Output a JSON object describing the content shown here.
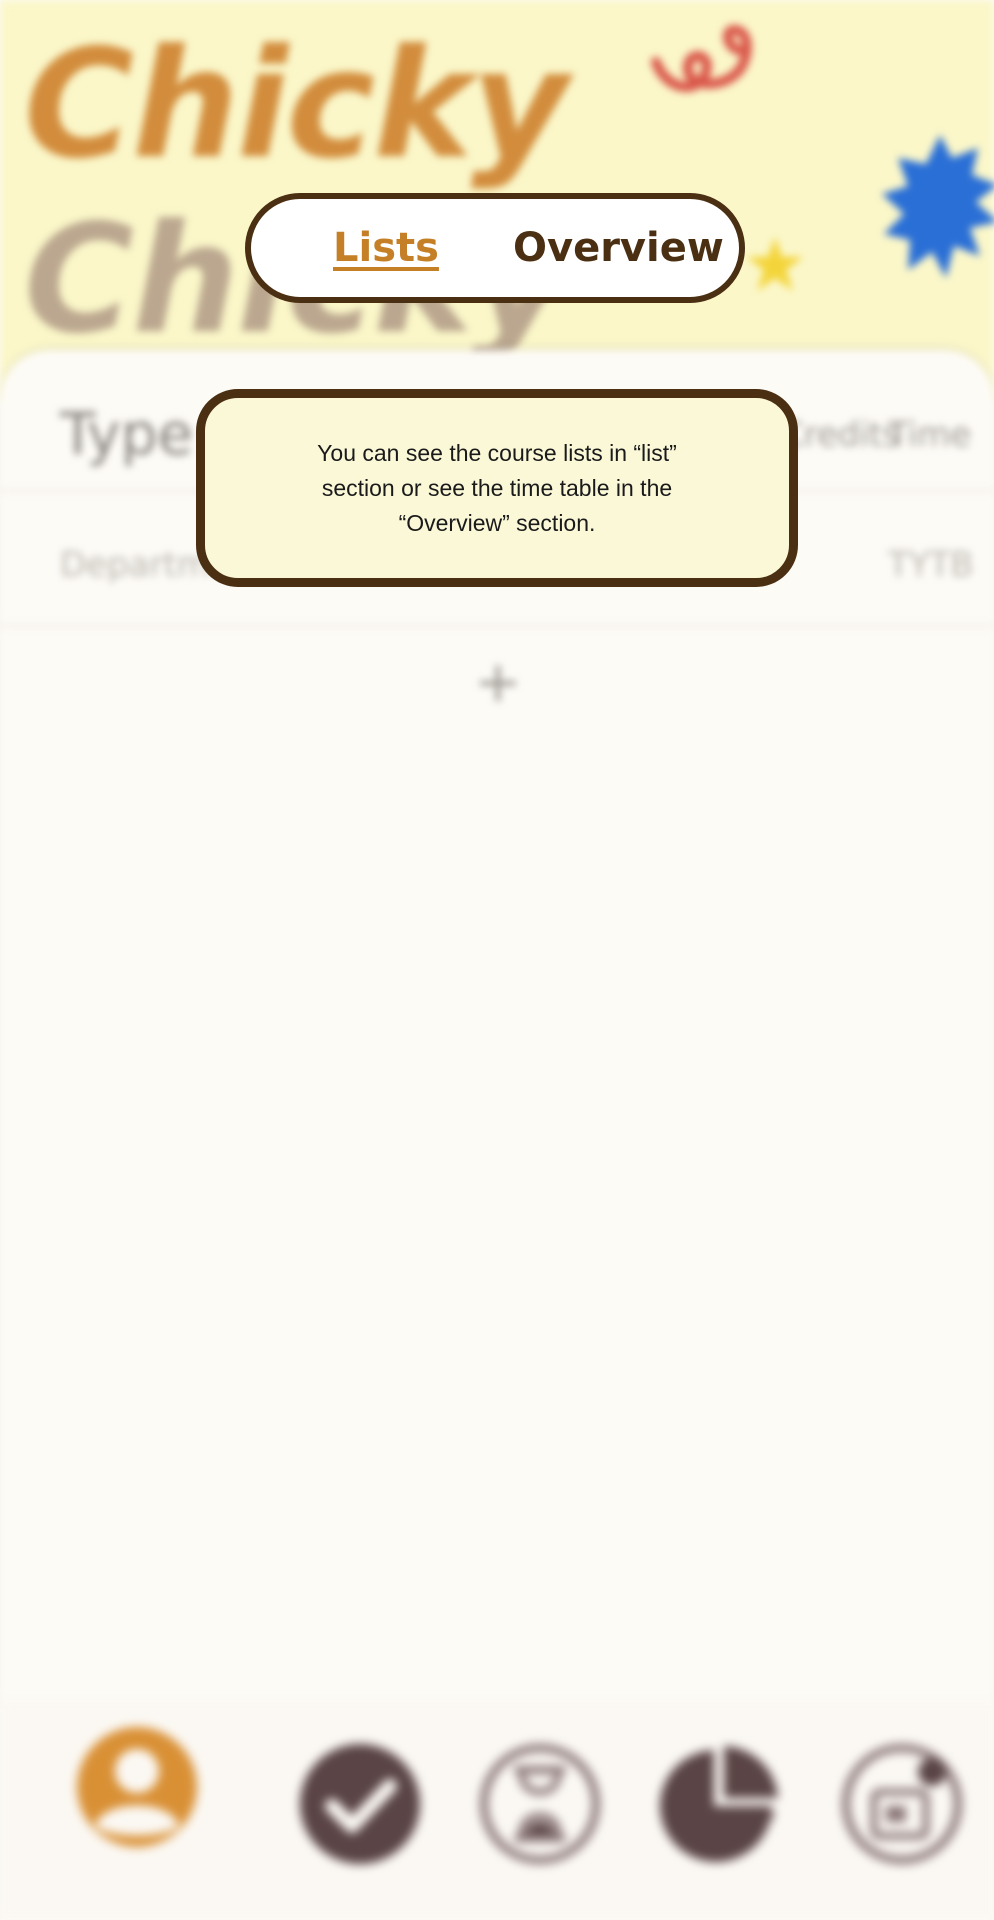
{
  "header": {
    "title_line1": "Chicky",
    "title_line2": "Chicky"
  },
  "tabs": [
    {
      "label": "Lists",
      "active": true
    },
    {
      "label": "Overview",
      "active": false
    }
  ],
  "tooltip": {
    "text": "You can see the course lists in “list” section or see the time table in the “Overview” section."
  },
  "table": {
    "headers": {
      "type": "Type",
      "credits": "Credits",
      "time": "Time"
    },
    "rows": [
      {
        "type": "Department",
        "time": "TYTB"
      }
    ],
    "add_label": "+"
  },
  "bottom_nav": {
    "items": [
      {
        "icon": "profile-icon",
        "active": true
      },
      {
        "icon": "check-icon",
        "active": false
      },
      {
        "icon": "hourglass-icon",
        "active": false
      },
      {
        "icon": "pie-chart-icon",
        "active": false
      },
      {
        "icon": "calendar-icon",
        "active": false
      }
    ]
  },
  "colors": {
    "accent": "#c47f27",
    "dark_brown": "#4b2f12",
    "header_bg": "#fbf7c9",
    "nav_icon": "#5a4445",
    "tooltip_bg": "#fbf8d8"
  }
}
